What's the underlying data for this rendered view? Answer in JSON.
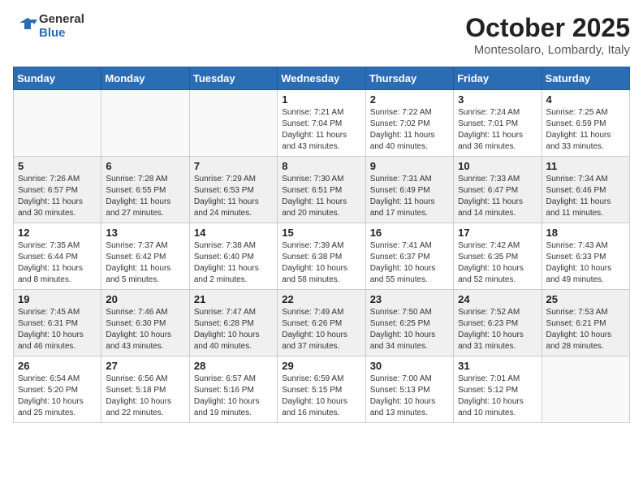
{
  "logo": {
    "general": "General",
    "blue": "Blue"
  },
  "title": "October 2025",
  "subtitle": "Montesolaro, Lombardy, Italy",
  "weekdays": [
    "Sunday",
    "Monday",
    "Tuesday",
    "Wednesday",
    "Thursday",
    "Friday",
    "Saturday"
  ],
  "weeks": [
    [
      {
        "day": "",
        "info": ""
      },
      {
        "day": "",
        "info": ""
      },
      {
        "day": "",
        "info": ""
      },
      {
        "day": "1",
        "info": "Sunrise: 7:21 AM\nSunset: 7:04 PM\nDaylight: 11 hours\nand 43 minutes."
      },
      {
        "day": "2",
        "info": "Sunrise: 7:22 AM\nSunset: 7:02 PM\nDaylight: 11 hours\nand 40 minutes."
      },
      {
        "day": "3",
        "info": "Sunrise: 7:24 AM\nSunset: 7:01 PM\nDaylight: 11 hours\nand 36 minutes."
      },
      {
        "day": "4",
        "info": "Sunrise: 7:25 AM\nSunset: 6:59 PM\nDaylight: 11 hours\nand 33 minutes."
      }
    ],
    [
      {
        "day": "5",
        "info": "Sunrise: 7:26 AM\nSunset: 6:57 PM\nDaylight: 11 hours\nand 30 minutes."
      },
      {
        "day": "6",
        "info": "Sunrise: 7:28 AM\nSunset: 6:55 PM\nDaylight: 11 hours\nand 27 minutes."
      },
      {
        "day": "7",
        "info": "Sunrise: 7:29 AM\nSunset: 6:53 PM\nDaylight: 11 hours\nand 24 minutes."
      },
      {
        "day": "8",
        "info": "Sunrise: 7:30 AM\nSunset: 6:51 PM\nDaylight: 11 hours\nand 20 minutes."
      },
      {
        "day": "9",
        "info": "Sunrise: 7:31 AM\nSunset: 6:49 PM\nDaylight: 11 hours\nand 17 minutes."
      },
      {
        "day": "10",
        "info": "Sunrise: 7:33 AM\nSunset: 6:47 PM\nDaylight: 11 hours\nand 14 minutes."
      },
      {
        "day": "11",
        "info": "Sunrise: 7:34 AM\nSunset: 6:46 PM\nDaylight: 11 hours\nand 11 minutes."
      }
    ],
    [
      {
        "day": "12",
        "info": "Sunrise: 7:35 AM\nSunset: 6:44 PM\nDaylight: 11 hours\nand 8 minutes."
      },
      {
        "day": "13",
        "info": "Sunrise: 7:37 AM\nSunset: 6:42 PM\nDaylight: 11 hours\nand 5 minutes."
      },
      {
        "day": "14",
        "info": "Sunrise: 7:38 AM\nSunset: 6:40 PM\nDaylight: 11 hours\nand 2 minutes."
      },
      {
        "day": "15",
        "info": "Sunrise: 7:39 AM\nSunset: 6:38 PM\nDaylight: 10 hours\nand 58 minutes."
      },
      {
        "day": "16",
        "info": "Sunrise: 7:41 AM\nSunset: 6:37 PM\nDaylight: 10 hours\nand 55 minutes."
      },
      {
        "day": "17",
        "info": "Sunrise: 7:42 AM\nSunset: 6:35 PM\nDaylight: 10 hours\nand 52 minutes."
      },
      {
        "day": "18",
        "info": "Sunrise: 7:43 AM\nSunset: 6:33 PM\nDaylight: 10 hours\nand 49 minutes."
      }
    ],
    [
      {
        "day": "19",
        "info": "Sunrise: 7:45 AM\nSunset: 6:31 PM\nDaylight: 10 hours\nand 46 minutes."
      },
      {
        "day": "20",
        "info": "Sunrise: 7:46 AM\nSunset: 6:30 PM\nDaylight: 10 hours\nand 43 minutes."
      },
      {
        "day": "21",
        "info": "Sunrise: 7:47 AM\nSunset: 6:28 PM\nDaylight: 10 hours\nand 40 minutes."
      },
      {
        "day": "22",
        "info": "Sunrise: 7:49 AM\nSunset: 6:26 PM\nDaylight: 10 hours\nand 37 minutes."
      },
      {
        "day": "23",
        "info": "Sunrise: 7:50 AM\nSunset: 6:25 PM\nDaylight: 10 hours\nand 34 minutes."
      },
      {
        "day": "24",
        "info": "Sunrise: 7:52 AM\nSunset: 6:23 PM\nDaylight: 10 hours\nand 31 minutes."
      },
      {
        "day": "25",
        "info": "Sunrise: 7:53 AM\nSunset: 6:21 PM\nDaylight: 10 hours\nand 28 minutes."
      }
    ],
    [
      {
        "day": "26",
        "info": "Sunrise: 6:54 AM\nSunset: 5:20 PM\nDaylight: 10 hours\nand 25 minutes."
      },
      {
        "day": "27",
        "info": "Sunrise: 6:56 AM\nSunset: 5:18 PM\nDaylight: 10 hours\nand 22 minutes."
      },
      {
        "day": "28",
        "info": "Sunrise: 6:57 AM\nSunset: 5:16 PM\nDaylight: 10 hours\nand 19 minutes."
      },
      {
        "day": "29",
        "info": "Sunrise: 6:59 AM\nSunset: 5:15 PM\nDaylight: 10 hours\nand 16 minutes."
      },
      {
        "day": "30",
        "info": "Sunrise: 7:00 AM\nSunset: 5:13 PM\nDaylight: 10 hours\nand 13 minutes."
      },
      {
        "day": "31",
        "info": "Sunrise: 7:01 AM\nSunset: 5:12 PM\nDaylight: 10 hours\nand 10 minutes."
      },
      {
        "day": "",
        "info": ""
      }
    ]
  ]
}
